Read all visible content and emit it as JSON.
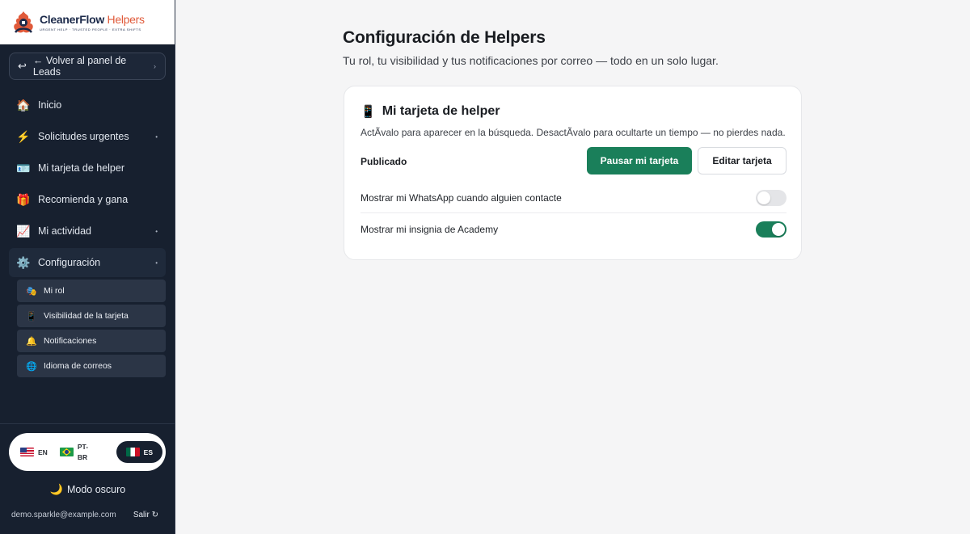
{
  "brand": {
    "name_main": "CleanerFlow",
    "name_accent": "Helpers",
    "tagline": "URGENT HELP · TRUSTED PEOPLE · EXTRA SHIFTS"
  },
  "sidebar": {
    "back_label": "← Volver al panel de Leads",
    "back_icon": "↩",
    "items": [
      {
        "label": "Inicio",
        "icon": "🏠",
        "icon_name": "home-icon"
      },
      {
        "label": "Solicitudes urgentes",
        "icon": "⚡",
        "icon_name": "lightning-icon"
      },
      {
        "label": "Mi tarjeta de helper",
        "icon": "🪪",
        "icon_name": "id-card-icon"
      },
      {
        "label": "Recomienda y gana",
        "icon": "🎁",
        "icon_name": "gift-icon"
      },
      {
        "label": "Mi actividad",
        "icon": "📈",
        "icon_name": "chart-icon"
      },
      {
        "label": "Configuración",
        "icon": "⚙️",
        "icon_name": "gear-icon"
      }
    ],
    "subitems": [
      {
        "label": "Mi rol",
        "icon": "🎭"
      },
      {
        "label": "Visibilidad de la tarjeta",
        "icon": "📱"
      },
      {
        "label": "Notificaciones",
        "icon": "🔔"
      },
      {
        "label": "Idioma de correos",
        "icon": "🌐"
      }
    ],
    "languages": [
      {
        "code": "EN"
      },
      {
        "code": "PT-BR"
      },
      {
        "code": "ES",
        "selected": true
      }
    ],
    "dark_mode_label": "Modo oscuro",
    "user_email": "demo.sparkle@example.com",
    "logout_label": "Salir ↻"
  },
  "main": {
    "title": "Configuración de Helpers",
    "subtitle": "Tu rol, tu visibilidad y tus notificaciones por correo — todo en un solo lugar.",
    "card": {
      "title": "Mi tarjeta de helper",
      "icon": "📱",
      "description": "ActÃvalo para aparecer en la búsqueda. DesactÃvalo para ocultarte un tiempo — no pierdes nada.",
      "status": "Publicado",
      "pause_label": "Pausar mi tarjeta",
      "edit_label": "Editar tarjeta",
      "toggles": [
        {
          "label": "Mostrar mi WhatsApp cuando alguien contacte",
          "on": false
        },
        {
          "label": "Mostrar mi insignia de Academy",
          "on": true
        }
      ]
    }
  },
  "colors": {
    "sidebar_bg": "#17202f",
    "primary_green": "#1a7f5a",
    "brand_orange": "#e05a3a",
    "brand_navy": "#1c2a4a"
  }
}
